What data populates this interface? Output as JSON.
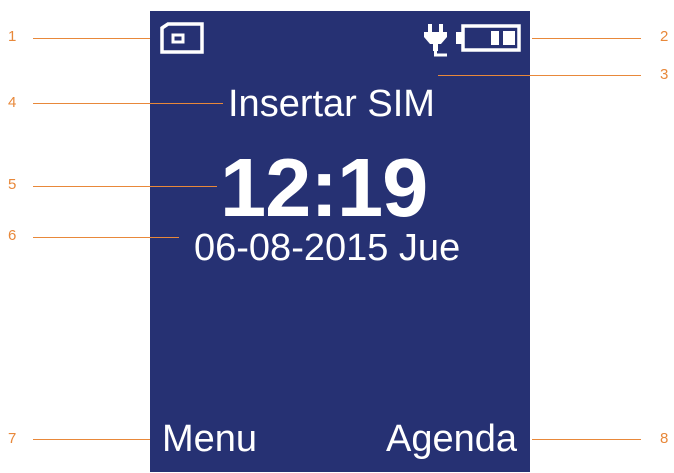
{
  "screen": {
    "background_color": "#263173",
    "text_color": "#ffffff",
    "status_message": "Insertar SIM",
    "time": "12:19",
    "date": "06-08-2015 Jue",
    "softkey_left": "Menu",
    "softkey_right": "Agenda",
    "icons": {
      "sim": "sim-card-icon",
      "charging": "charging-plug-icon",
      "battery": "battery-icon"
    },
    "battery_level": 0.5
  },
  "callouts": {
    "color": "#E8883A",
    "labels": [
      "1",
      "2",
      "3",
      "4",
      "5",
      "6",
      "7",
      "8"
    ]
  }
}
